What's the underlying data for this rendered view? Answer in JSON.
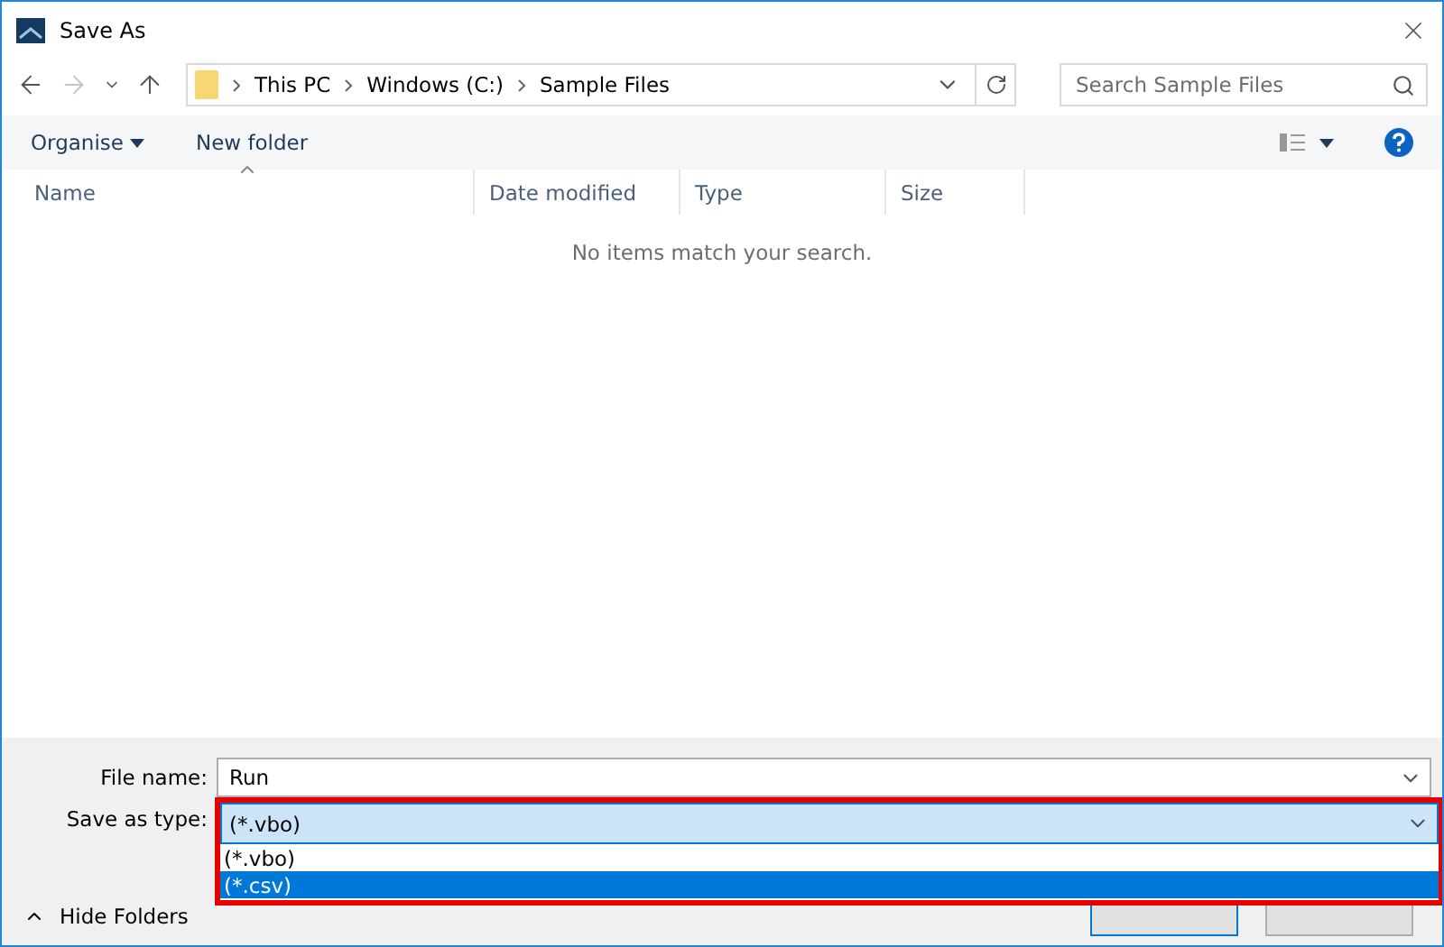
{
  "window": {
    "title": "Save As"
  },
  "nav": {
    "back_disabled": false,
    "forward_disabled": true
  },
  "address": {
    "path": [
      "This PC",
      "Windows (C:)",
      "Sample Files"
    ]
  },
  "search": {
    "placeholder": "Search Sample Files"
  },
  "toolbar": {
    "buttons": [
      "Organise",
      "New folder"
    ]
  },
  "columns": [
    {
      "label": "Name",
      "sorted": true
    },
    {
      "label": "Date modified",
      "sorted": false
    },
    {
      "label": "Type",
      "sorted": false
    },
    {
      "label": "Size",
      "sorted": false
    }
  ],
  "empty_message": "No items match your search.",
  "form": {
    "file_name_label": "File name:",
    "file_name": "Run",
    "type_label": "Save as type:",
    "type_value": "(*.vbo)",
    "type_options": [
      {
        "label": "(*.vbo)",
        "selected": false
      },
      {
        "label": "(*.csv)",
        "selected": true
      }
    ]
  },
  "hide_folders": "Hide Folders"
}
